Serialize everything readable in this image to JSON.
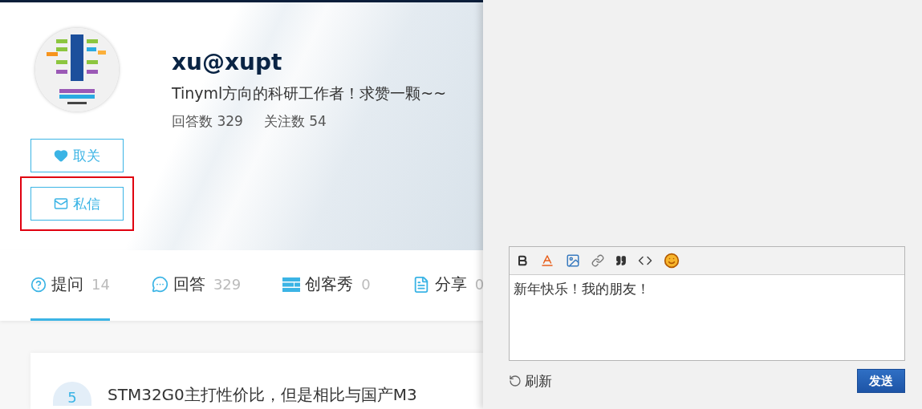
{
  "profile": {
    "name": "xu@xupt",
    "bio": "Tinyml方向的科研工作者！求赞一颗~~",
    "stats": [
      {
        "label": "回答数",
        "value": "329"
      },
      {
        "label": "关注数",
        "value": "54"
      }
    ],
    "buttons": [
      {
        "kind": "follow",
        "label": "取关",
        "highlighted": false
      },
      {
        "kind": "message",
        "label": "私信",
        "highlighted": true
      }
    ]
  },
  "tabs": [
    {
      "kind": "question",
      "label": "提问",
      "count": "14",
      "selected": true
    },
    {
      "kind": "answer",
      "label": "回答",
      "count": "329",
      "selected": false
    },
    {
      "kind": "maker",
      "label": "创客秀",
      "count": "0",
      "selected": false
    },
    {
      "kind": "share",
      "label": "分享",
      "count": "0",
      "selected": false
    }
  ],
  "posts": [
    {
      "number": "5",
      "title": "STM32G0主打性价比，但是相比与国产M3"
    }
  ],
  "message_panel": {
    "text": "新年快乐！我的朋友！",
    "refresh": "刷新",
    "send": "发送"
  }
}
